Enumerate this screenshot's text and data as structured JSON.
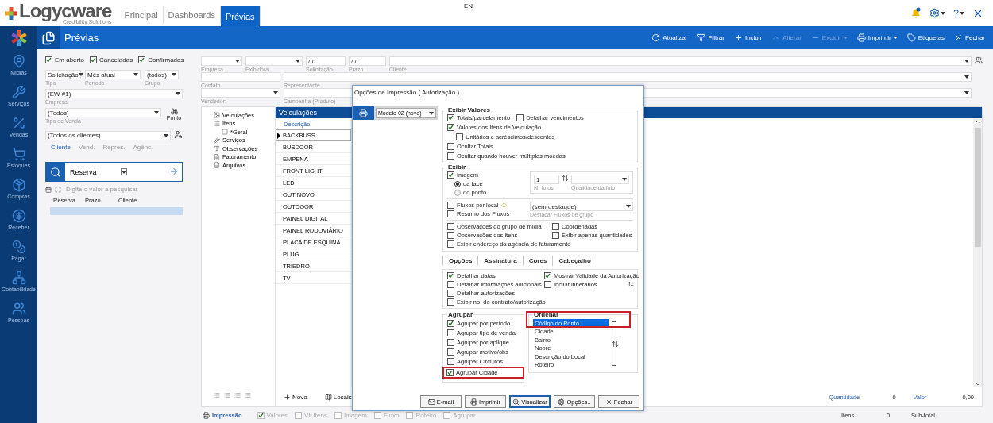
{
  "topbar": {
    "logo": "Logycware",
    "tagline": "Credibility Solutions",
    "tabs": [
      {
        "label": "Principal",
        "selected": false
      },
      {
        "label": "Dashboards",
        "selected": false
      },
      {
        "label": "Prévias",
        "selected": true
      }
    ],
    "language": "EN",
    "help": "?"
  },
  "sidebar": {
    "items": [
      {
        "label": "Mídias",
        "kind": "pin"
      },
      {
        "label": "Serviços",
        "kind": "tools"
      },
      {
        "label": "Vendas",
        "kind": "percent"
      },
      {
        "label": "Estoques",
        "kind": "cart"
      },
      {
        "label": "Compras",
        "kind": "box"
      },
      {
        "label": "Receber",
        "kind": "coin"
      },
      {
        "label": "Pagar",
        "kind": "coins"
      },
      {
        "label": "Contabilidade",
        "kind": "network"
      },
      {
        "label": "Pessoas",
        "kind": "people"
      }
    ]
  },
  "header": {
    "title": "Prévias",
    "toolbar": [
      {
        "label": "Atualizar",
        "kind": "refresh",
        "disabled": false,
        "menu": false
      },
      {
        "label": "Filtrar",
        "kind": "filter",
        "disabled": false,
        "menu": false
      },
      {
        "label": "Incluir",
        "kind": "plus",
        "disabled": false,
        "menu": false
      },
      {
        "label": "Alterar",
        "kind": "edit",
        "disabled": true,
        "menu": false
      },
      {
        "label": "Excluir",
        "kind": "minus",
        "disabled": true,
        "menu": true
      },
      {
        "label": "Imprimir",
        "kind": "print",
        "disabled": false,
        "menu": true
      },
      {
        "label": "Etiquetas",
        "kind": "tag",
        "disabled": false,
        "menu": false
      },
      {
        "label": "Fechar",
        "kind": "close",
        "disabled": false,
        "menu": false
      }
    ]
  },
  "left_panel": {
    "statuses": [
      {
        "label": "Em aberto",
        "checked": true
      },
      {
        "label": "Canceladas",
        "checked": true
      },
      {
        "label": "Confirmadas",
        "checked": true
      }
    ],
    "tipo": {
      "value": "Solicitação",
      "label": "Tipo"
    },
    "periodo": {
      "value": "Mês atual",
      "label": "Período"
    },
    "grupo": {
      "value": "(todos)",
      "label": "Grupo"
    },
    "empresa": {
      "value": "(EW #1)",
      "label": "Empresa"
    },
    "tipo_venda": {
      "value": "(Todos)",
      "label": "Tipo de Venda"
    },
    "ponto": "Ponto",
    "cliente": {
      "value": "(Todos os clientes)"
    },
    "search_tabs": [
      {
        "label": "Cliente",
        "selected": true
      },
      {
        "label": "Vend.",
        "selected": false
      },
      {
        "label": "Repres.",
        "selected": false
      },
      {
        "label": "Agênc.",
        "selected": false
      }
    ],
    "search": {
      "field": "Reserva",
      "placeholder": "Digite o valor a pesquisar"
    },
    "columns": [
      "Reserva",
      "Prazo",
      "Cliente"
    ]
  },
  "filters": {
    "empresa": {
      "label": "Empresa"
    },
    "exibidora": {
      "label": "Exibidora"
    },
    "solicitacao": {
      "label": "Solicitação",
      "value": "/ /"
    },
    "prazo": {
      "label": "Prazo",
      "value": "/ /"
    },
    "cliente": {
      "label": "Cliente"
    },
    "contato": {
      "label": "Contato"
    },
    "representante": {
      "label": "Representante"
    },
    "vendedor": {
      "label": "Vendedor:"
    },
    "campanha": {
      "label": "Campanha (Produto)"
    }
  },
  "tree": {
    "items": [
      {
        "label": "Veiculações",
        "kind": "media"
      },
      {
        "label": "Itens",
        "kind": "items",
        "children": [
          {
            "label": "*Geral",
            "kind": "square"
          }
        ]
      },
      {
        "label": "Serviços",
        "kind": "tools"
      },
      {
        "label": "Observações",
        "kind": "text"
      },
      {
        "label": "Faturamento",
        "kind": "invoice"
      },
      {
        "label": "Arquivos",
        "kind": "file"
      }
    ]
  },
  "veiculacoes": {
    "title": "Veiculações",
    "column": "Descrição",
    "rows": [
      {
        "label": "BACKBUSS",
        "selected": true
      },
      {
        "label": "BUSDOOR",
        "selected": false
      },
      {
        "label": "EMPENA",
        "selected": false
      },
      {
        "label": "FRONT LIGHT",
        "selected": false
      },
      {
        "label": "LED",
        "selected": false
      },
      {
        "label": "OUT NOVO",
        "selected": false
      },
      {
        "label": "OUTDOOR",
        "selected": false
      },
      {
        "label": "PAINEL DIGITAL",
        "selected": false
      },
      {
        "label": "PAINEL RODOVIÁRIO",
        "selected": false
      },
      {
        "label": "PLACA DE ESQUINA",
        "selected": false
      },
      {
        "label": "PLUG",
        "selected": false
      },
      {
        "label": "TRIEDRO",
        "selected": false
      },
      {
        "label": "TV",
        "selected": false
      }
    ],
    "actions": [
      {
        "label": "Novo",
        "kind": "plus"
      },
      {
        "label": "Locais",
        "kind": "map"
      }
    ]
  },
  "totals": {
    "quantidade_label": "Quantidade",
    "quantidade": "0",
    "valor_label": "Valor",
    "valor": "0,00"
  },
  "status_bar": {
    "title": "Impressão",
    "options": [
      {
        "label": "Valores",
        "checked": true
      },
      {
        "label": "Vlr.Itens",
        "checked": false
      },
      {
        "label": "Imagem",
        "checked": false
      },
      {
        "label": "Fluxo",
        "checked": false
      },
      {
        "label": "Roteiro",
        "checked": false
      },
      {
        "label": "Agrupar",
        "checked": false
      }
    ],
    "itens_label": "Itens",
    "itens": "0",
    "subtotal_label": "Sub-total"
  },
  "dialog": {
    "title": "Opções de Impressão ( Autorização )",
    "model": "Modelo 02 (novo)",
    "exibir_valores": {
      "title": "Exibir Valores",
      "rows": [
        [
          {
            "label": "Totais/parcelamento",
            "checked": true,
            "kind": "main"
          },
          {
            "label": "Detalhar vencimentos",
            "checked": false,
            "kind": "main"
          }
        ],
        [
          {
            "label": "Valores dos Itens de Veiculação",
            "checked": true,
            "kind": "main"
          }
        ],
        [
          {
            "label": "Unitários e acréscimos/descontos",
            "checked": false,
            "kind": "sub"
          }
        ],
        [
          {
            "label": "Ocultar Totais",
            "checked": false,
            "kind": "main"
          }
        ],
        [
          {
            "label": "Ocultar quando houver múltiplas moedas",
            "checked": false,
            "kind": "main"
          }
        ]
      ]
    },
    "exibir": {
      "title": "Exibir",
      "imagem": {
        "label": "Imagem",
        "checked": true
      },
      "modes": [
        {
          "label": "da face",
          "selected": true
        },
        {
          "label": "do ponto",
          "selected": false
        }
      ],
      "fotos": {
        "value": "1",
        "label": "Nº fotos"
      },
      "qualidade": {
        "label": "Qualidade da foto"
      },
      "fluxos": [
        {
          "label": "Fluxos por local",
          "checked": false
        },
        {
          "label": "Resumo dos Fluxos",
          "checked": false
        }
      ],
      "destaque": {
        "value": "(sem destaque)",
        "label": "Destacar Fluxos de grupo"
      },
      "extras": [
        [
          {
            "label": "Observações do grupo de mídia",
            "checked": false
          },
          {
            "label": "Coordenadas",
            "checked": false
          }
        ],
        [
          {
            "label": "Observações dos itens",
            "checked": false
          },
          {
            "label": "Exibir apenas quantidades",
            "checked": false
          }
        ],
        [
          {
            "label": "Exibir endereço da agência de faturamento",
            "checked": false
          }
        ]
      ]
    },
    "tabs": [
      {
        "label": "Opções",
        "selected": true
      },
      {
        "label": "Assinatura",
        "selected": false
      },
      {
        "label": "Cores",
        "selected": false
      },
      {
        "label": "Cabeçalho",
        "selected": false
      }
    ],
    "opcoes": [
      [
        {
          "label": "Detalhar datas",
          "checked": true
        },
        {
          "label": "Mostrar Validade da Autorização",
          "checked": true
        }
      ],
      [
        {
          "label": "Detalhar informações adicionais",
          "checked": false
        },
        {
          "label": "Incluir itinerários",
          "checked": false
        }
      ],
      [
        {
          "label": "Detalhar autorizações",
          "checked": false
        }
      ],
      [
        {
          "label": "Exibir no. do contrato/autorização",
          "checked": false
        }
      ]
    ],
    "agrupar": {
      "title": "Agrupar",
      "options": [
        {
          "label": "Agrupar por período",
          "checked": true,
          "highlighted": false
        },
        {
          "label": "Agrupar tipo de venda",
          "checked": false,
          "highlighted": false
        },
        {
          "label": "Agrupar por aplique",
          "checked": false,
          "highlighted": false
        },
        {
          "label": "Agrupar motivo/obs",
          "checked": false,
          "highlighted": false
        },
        {
          "label": "Agrupar Circuitos",
          "checked": false,
          "highlighted": false
        },
        {
          "label": "Agrupar Cidade",
          "checked": true,
          "highlighted": true
        }
      ]
    },
    "ordenar": {
      "title": "Ordenar",
      "highlighted": true,
      "items": [
        {
          "label": "Código do Ponto",
          "selected": true
        },
        {
          "label": "Cidade",
          "selected": false
        },
        {
          "label": "Bairro",
          "selected": false
        },
        {
          "label": "Nobre",
          "selected": false
        },
        {
          "label": "Descrição do Local",
          "selected": false
        },
        {
          "label": "Roteiro",
          "selected": false
        }
      ]
    },
    "buttons": [
      {
        "label": "E-mail",
        "kind": "mail",
        "focused": false
      },
      {
        "label": "Imprimir",
        "kind": "print",
        "focused": false
      },
      {
        "label": "Visualizar",
        "kind": "preview",
        "focused": true
      },
      {
        "label": "Opções..",
        "kind": "options",
        "focused": false
      },
      {
        "label": "Fechar",
        "kind": "close",
        "focused": false
      }
    ]
  }
}
